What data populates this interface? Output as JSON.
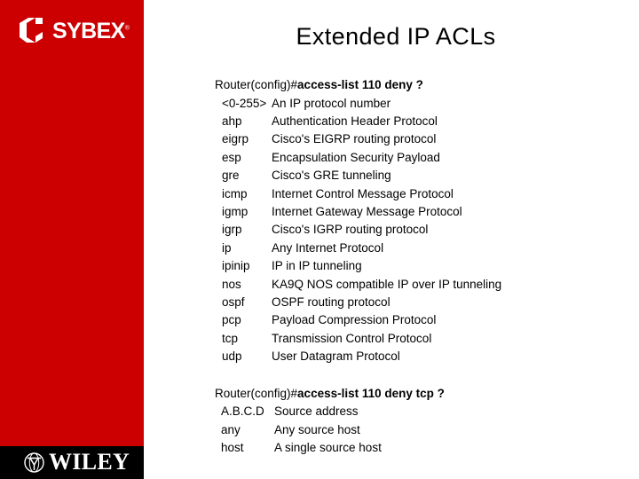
{
  "slide": {
    "title": "Extended IP ACLs"
  },
  "brand": {
    "sybex_name": "SYBEX",
    "sybex_trademark": "®",
    "sybex_icon": "sybex-cube-logo",
    "wiley_name": "WILEY",
    "wiley_icon": "wiley-globe-logo",
    "red": "#cc0000",
    "black": "#000000"
  },
  "blocks": [
    {
      "prompt": "Router(config)#",
      "command": "access-list 110 deny ?",
      "options": [
        {
          "keyword": "<0-255>",
          "description": "An IP protocol number"
        },
        {
          "keyword": "ahp",
          "description": "Authentication Header Protocol"
        },
        {
          "keyword": "eigrp",
          "description": "Cisco's EIGRP routing protocol"
        },
        {
          "keyword": "esp",
          "description": "Encapsulation Security Payload"
        },
        {
          "keyword": "gre",
          "description": "Cisco's GRE tunneling"
        },
        {
          "keyword": "icmp",
          "description": "Internet Control Message Protocol"
        },
        {
          "keyword": "igmp",
          "description": "Internet Gateway Message Protocol"
        },
        {
          "keyword": "igrp",
          "description": "Cisco's IGRP routing protocol"
        },
        {
          "keyword": "ip",
          "description": "Any Internet Protocol"
        },
        {
          "keyword": "ipinip",
          "description": "IP in IP tunneling"
        },
        {
          "keyword": "nos",
          "description": "KA9Q NOS compatible IP over IP tunneling"
        },
        {
          "keyword": "ospf",
          "description": "OSPF routing protocol"
        },
        {
          "keyword": "pcp",
          "description": "Payload Compression Protocol"
        },
        {
          "keyword": "tcp",
          "description": "Transmission Control Protocol"
        },
        {
          "keyword": "udp",
          "description": "User Datagram Protocol"
        }
      ]
    },
    {
      "prompt": "Router(config)#",
      "command": "access-list 110 deny tcp ?",
      "options": [
        {
          "keyword": "A.B.C.D",
          "description": "Source address"
        },
        {
          "keyword": "any",
          "description": "Any source host"
        },
        {
          "keyword": "host",
          "description": "A single source host"
        }
      ]
    }
  ]
}
